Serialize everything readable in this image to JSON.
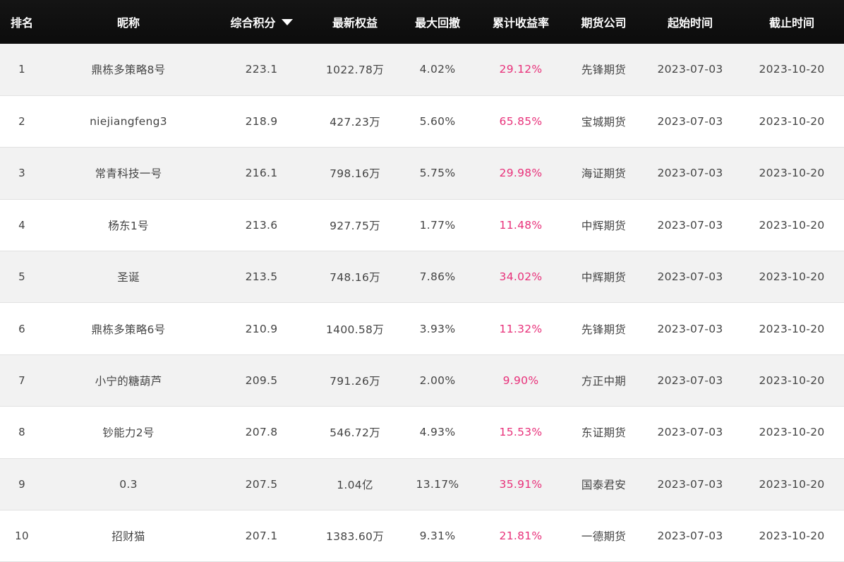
{
  "colors": {
    "header_bg": "#111111",
    "header_text": "#ffffff",
    "row_alt_bg": "#f2f2f2",
    "text": "#444444",
    "return_positive": "#e8317a"
  },
  "header": {
    "rank": "排名",
    "nickname": "昵称",
    "score": "综合积分",
    "sort_icon": "caret-down-icon",
    "equity": "最新权益",
    "max_drawdown": "最大回撤",
    "cumulative_return": "累计收益率",
    "broker": "期货公司",
    "start_date": "起始时间",
    "end_date": "截止时间"
  },
  "rows": [
    {
      "rank": "1",
      "nickname": "鼎栋多策略8号",
      "score": "223.1",
      "equity": "1022.78万",
      "max_drawdown": "4.02%",
      "cumulative_return": "29.12%",
      "broker": "先锋期货",
      "start_date": "2023-07-03",
      "end_date": "2023-10-20"
    },
    {
      "rank": "2",
      "nickname": "niejiangfeng3",
      "score": "218.9",
      "equity": "427.23万",
      "max_drawdown": "5.60%",
      "cumulative_return": "65.85%",
      "broker": "宝城期货",
      "start_date": "2023-07-03",
      "end_date": "2023-10-20"
    },
    {
      "rank": "3",
      "nickname": "常青科技一号",
      "score": "216.1",
      "equity": "798.16万",
      "max_drawdown": "5.75%",
      "cumulative_return": "29.98%",
      "broker": "海证期货",
      "start_date": "2023-07-03",
      "end_date": "2023-10-20"
    },
    {
      "rank": "4",
      "nickname": "杨东1号",
      "score": "213.6",
      "equity": "927.75万",
      "max_drawdown": "1.77%",
      "cumulative_return": "11.48%",
      "broker": "中辉期货",
      "start_date": "2023-07-03",
      "end_date": "2023-10-20"
    },
    {
      "rank": "5",
      "nickname": "圣诞",
      "score": "213.5",
      "equity": "748.16万",
      "max_drawdown": "7.86%",
      "cumulative_return": "34.02%",
      "broker": "中辉期货",
      "start_date": "2023-07-03",
      "end_date": "2023-10-20"
    },
    {
      "rank": "6",
      "nickname": "鼎栋多策略6号",
      "score": "210.9",
      "equity": "1400.58万",
      "max_drawdown": "3.93%",
      "cumulative_return": "11.32%",
      "broker": "先锋期货",
      "start_date": "2023-07-03",
      "end_date": "2023-10-20"
    },
    {
      "rank": "7",
      "nickname": "小宁的糖葫芦",
      "score": "209.5",
      "equity": "791.26万",
      "max_drawdown": "2.00%",
      "cumulative_return": "9.90%",
      "broker": "方正中期",
      "start_date": "2023-07-03",
      "end_date": "2023-10-20"
    },
    {
      "rank": "8",
      "nickname": "钞能力2号",
      "score": "207.8",
      "equity": "546.72万",
      "max_drawdown": "4.93%",
      "cumulative_return": "15.53%",
      "broker": "东证期货",
      "start_date": "2023-07-03",
      "end_date": "2023-10-20"
    },
    {
      "rank": "9",
      "nickname": "0.3",
      "score": "207.5",
      "equity": "1.04亿",
      "max_drawdown": "13.17%",
      "cumulative_return": "35.91%",
      "broker": "国泰君安",
      "start_date": "2023-07-03",
      "end_date": "2023-10-20"
    },
    {
      "rank": "10",
      "nickname": "招财猫",
      "score": "207.1",
      "equity": "1383.60万",
      "max_drawdown": "9.31%",
      "cumulative_return": "21.81%",
      "broker": "一德期货",
      "start_date": "2023-07-03",
      "end_date": "2023-10-20"
    }
  ]
}
